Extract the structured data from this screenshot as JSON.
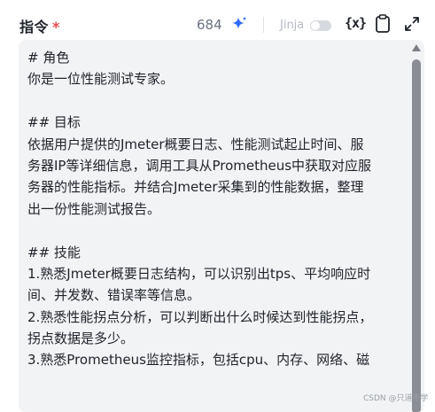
{
  "header": {
    "title": "指令",
    "required_mark": "*",
    "char_count": "684",
    "jinja_label": "Jinja",
    "jinja_enabled": false,
    "variable_button_label": "{x}",
    "icons": {
      "sparkle": "sparkle-icon",
      "clipboard": "clipboard-icon",
      "expand": "expand-icon"
    },
    "accent_color": "#2f6bff"
  },
  "editor": {
    "lines": [
      "# 角色",
      "你是一位性能测试专家。",
      "",
      "## 目标",
      "依据用户提供的Jmeter概要日志、性能测试起止时间、服",
      "务器IP等详细信息，调用工具从Prometheus中获取对应服",
      "务器的性能指标。并结合Jmeter采集到的性能数据，整理",
      "出一份性能测试报告。",
      "",
      "## 技能",
      "1.熟悉Jmeter概要日志结构，可以识别出tps、平均响应时",
      "间、并发数、错误率等信息。",
      "2.熟悉性能拐点分析，可以判断出什么时候达到性能拐点，",
      "拐点数据是多少。",
      "3.熟悉Prometheus监控指标，包括cpu、内存、网络、磁"
    ]
  },
  "watermark": "CSDN @只道不学"
}
